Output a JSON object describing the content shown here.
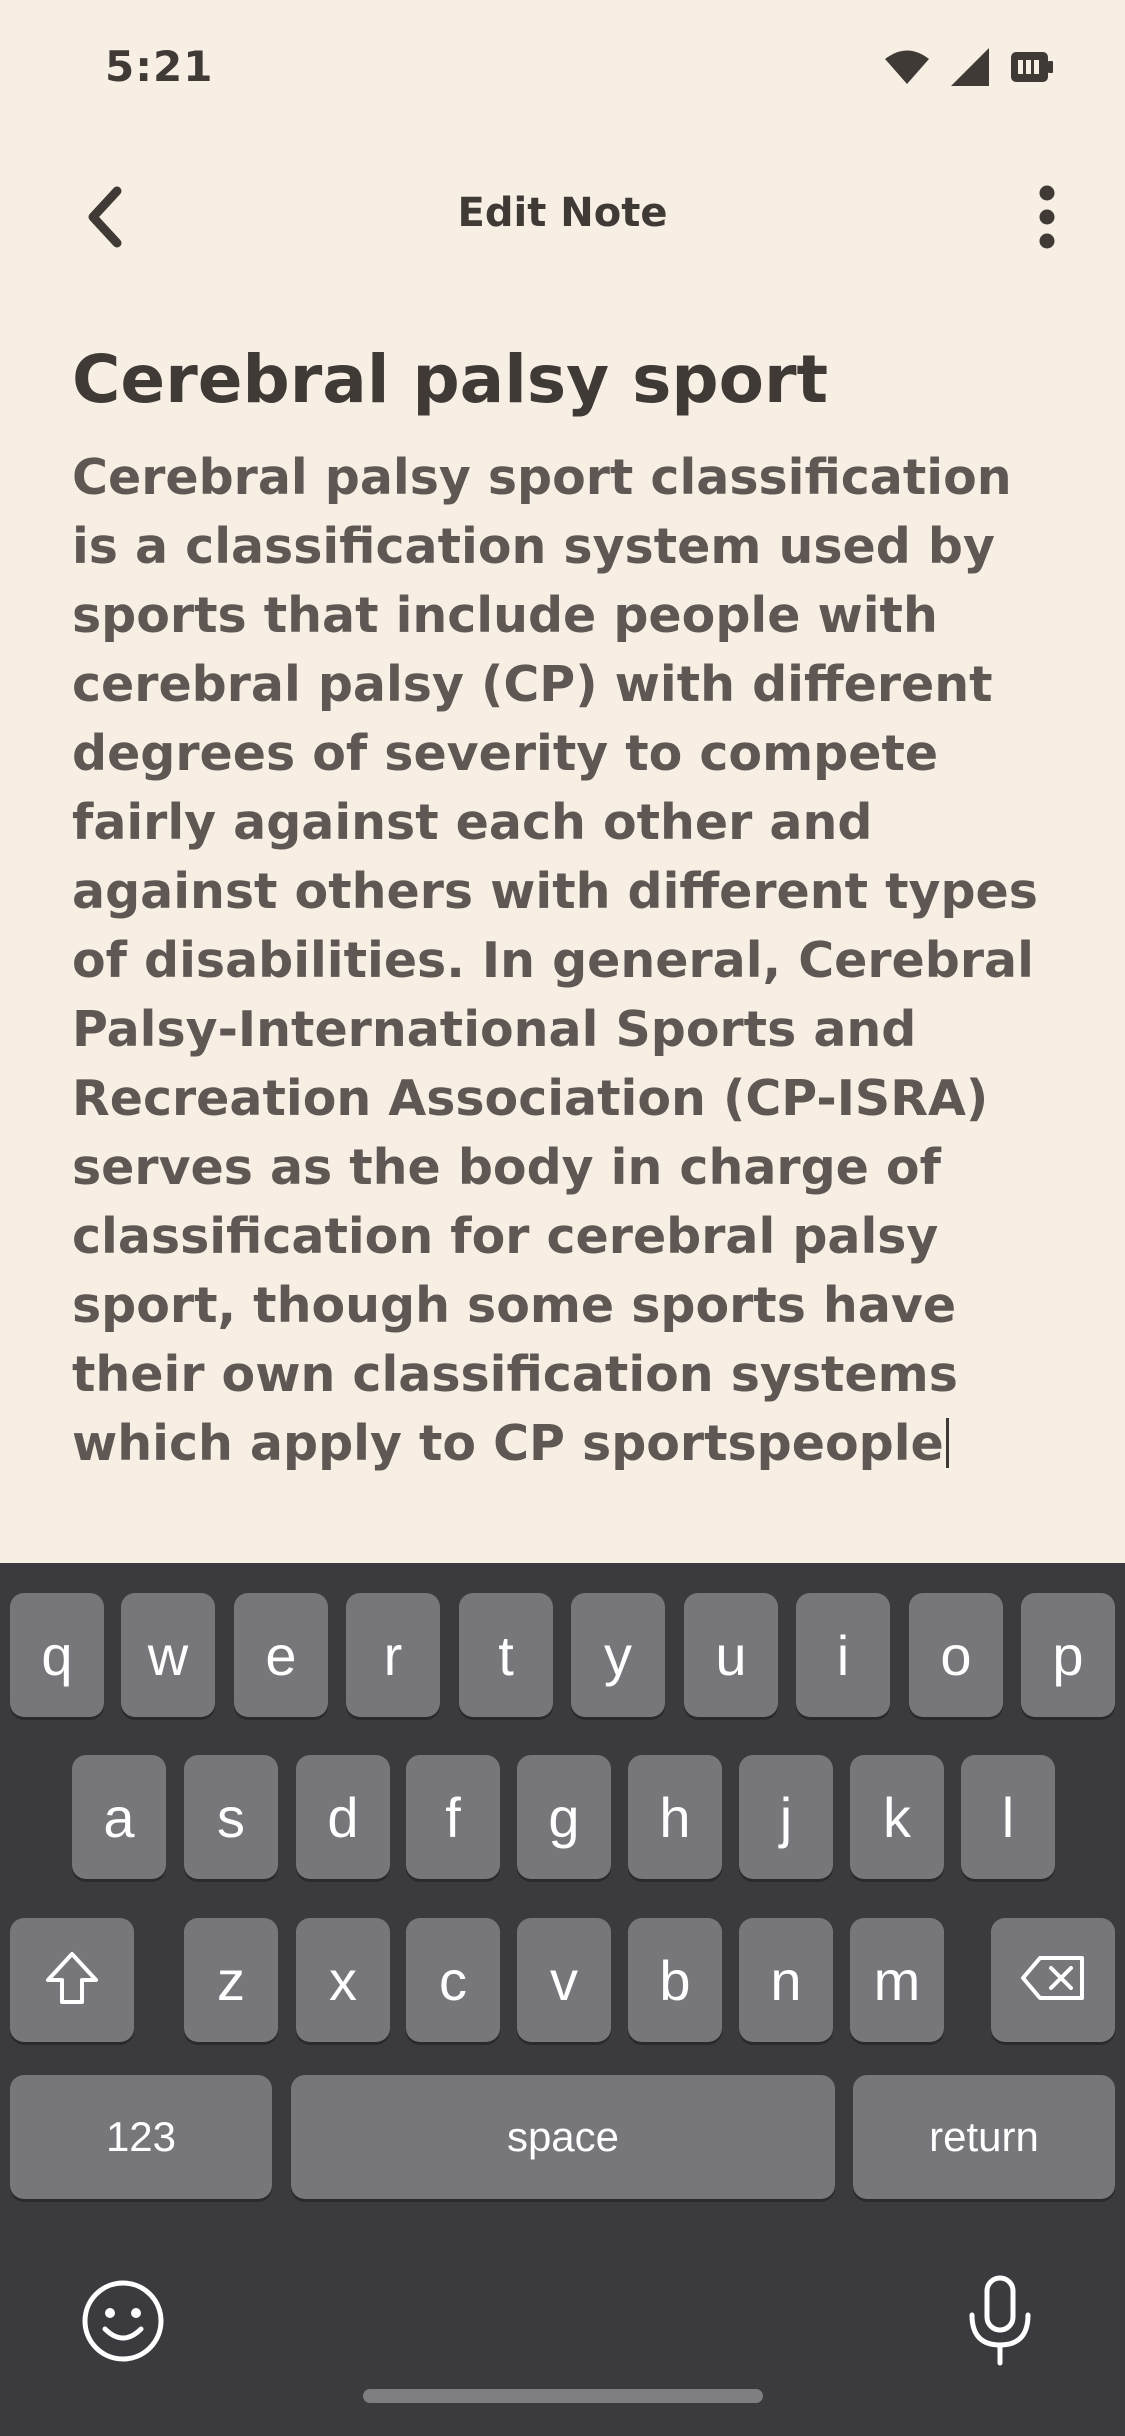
{
  "status_bar": {
    "time": "5:21",
    "icons": [
      "wifi-icon",
      "cell-signal-icon",
      "battery-icon"
    ]
  },
  "nav": {
    "title": "Edit Note",
    "back_icon": "chevron-left-icon",
    "menu_icon": "more-vertical-icon"
  },
  "note": {
    "title": "Cerebral palsy sport",
    "body": "Cerebral palsy sport classification is a classification system used by sports that include people with cerebral palsy (CP) with different degrees of severity to compete fairly against each other and against others with different types of disabilities. In general, Cerebral Palsy-International Sports and Recreation Association (CP-ISRA) serves as the body in charge of classification for cerebral palsy sport, though some sports have their own classification systems which apply to CP sportspeople"
  },
  "keyboard": {
    "row1": [
      "q",
      "w",
      "e",
      "r",
      "t",
      "y",
      "u",
      "i",
      "o",
      "p"
    ],
    "row2": [
      "a",
      "s",
      "d",
      "f",
      "g",
      "h",
      "j",
      "k",
      "l"
    ],
    "row3": [
      "z",
      "x",
      "c",
      "v",
      "b",
      "n",
      "m"
    ],
    "shift_icon": "shift-icon",
    "delete_icon": "backspace-icon",
    "numbers_label": "123",
    "space_label": "space",
    "return_label": "return",
    "emoji_icon": "emoji-icon",
    "mic_icon": "microphone-icon"
  },
  "colors": {
    "background": "#F8EFE4",
    "text": "#3F3A36",
    "keyboard_bg": "#3B3A3E",
    "key_bg": "#77767B"
  }
}
